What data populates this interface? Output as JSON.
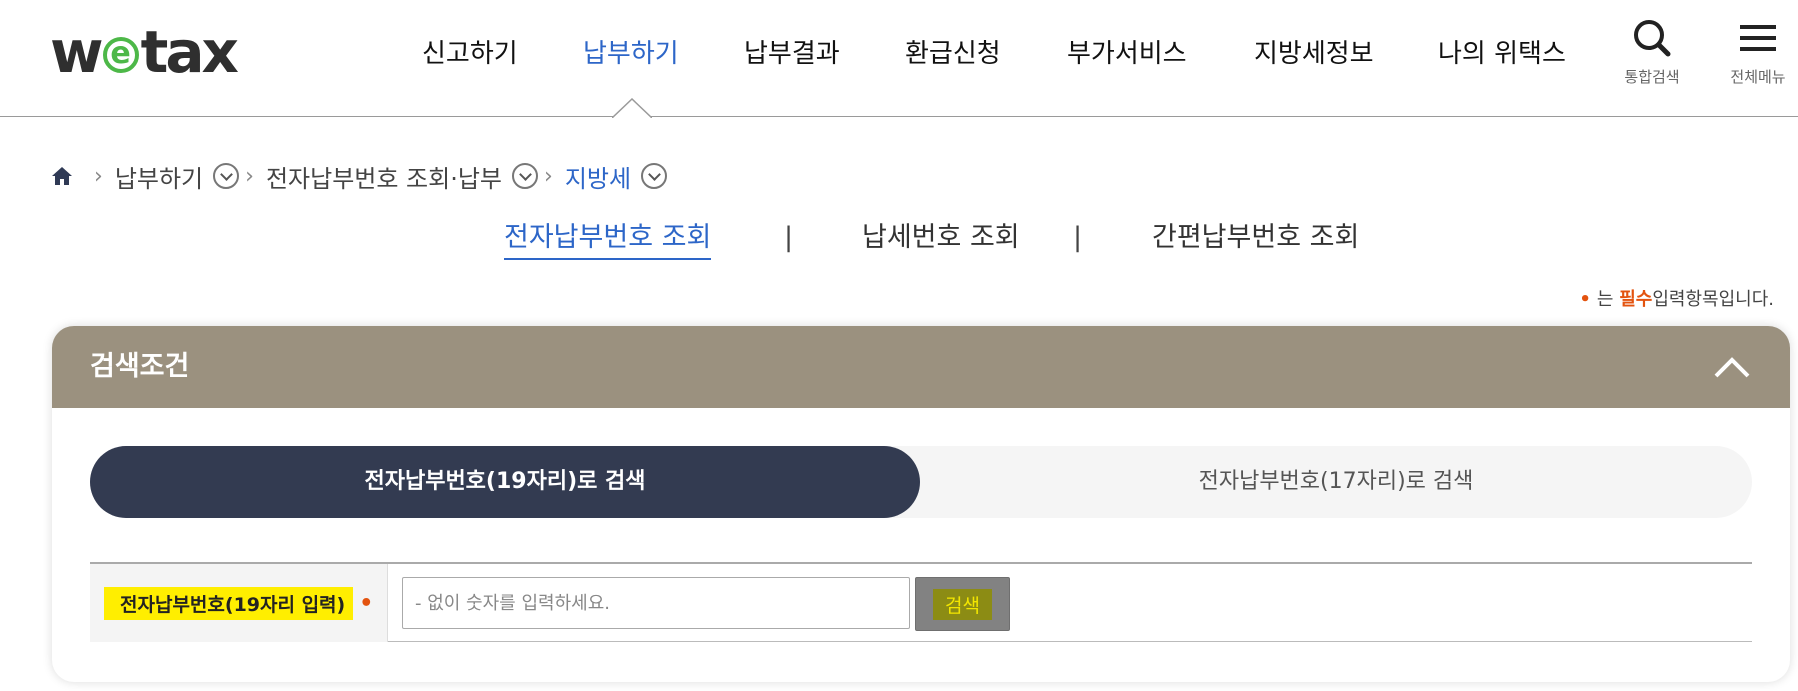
{
  "header": {
    "logo": {
      "part1": "w",
      "part2": "e",
      "part3": "tax"
    },
    "nav": [
      {
        "label": "신고하기",
        "active": false
      },
      {
        "label": "납부하기",
        "active": true
      },
      {
        "label": "납부결과",
        "active": false
      },
      {
        "label": "환급신청",
        "active": false
      },
      {
        "label": "부가서비스",
        "active": false
      },
      {
        "label": "지방세정보",
        "active": false
      },
      {
        "label": "나의 위택스",
        "active": false
      }
    ],
    "search_label": "통합검색",
    "menu_label": "전체메뉴"
  },
  "breadcrumb": {
    "items": [
      "납부하기",
      "전자납부번호 조회·납부",
      "지방세"
    ]
  },
  "subtabs": {
    "items": [
      "전자납부번호 조회",
      "납세번호 조회",
      "간편납부번호 조회"
    ],
    "separator": "|",
    "active_index": 0
  },
  "required_note": {
    "dot": "•",
    "prefix": "는",
    "word": "필수",
    "suffix": "입력항목입니다."
  },
  "panel": {
    "title": "검색조건",
    "toggle": {
      "option_on": "전자납부번호(19자리)로 검색",
      "option_off": "전자납부번호(17자리)로 검색"
    },
    "field": {
      "label": "전자납부번호(19자리 입력)",
      "required_dot": "•",
      "placeholder": "- 없이 숫자를 입력하세요.",
      "value": ""
    },
    "search_button": "검색"
  },
  "colors": {
    "accent_blue": "#2d66c8",
    "panel_header": "#9b917f",
    "toggle_active": "#333b51",
    "required": "#e3530f",
    "logo_green": "#4db848",
    "highlight": "#ffee00"
  }
}
